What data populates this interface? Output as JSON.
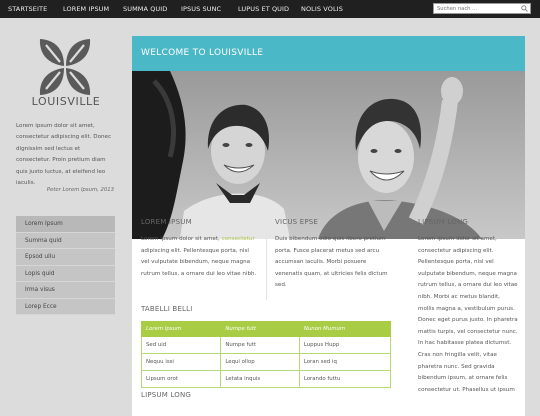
{
  "nav": {
    "items": [
      "STARTSEITE",
      "LOREM IPSUM",
      "SUMMA QUID",
      "IPSUS SUNC",
      "LUPUS ET QUID",
      "NOLIS VOLIS"
    ],
    "search_placeholder": "Suchen nach ..."
  },
  "sidebar": {
    "brand": "LOUISVILLE",
    "intro": "Lorem ipsum dolor sit amet, consectetur adipiscing elit. Donec dignissim sed lectus et consectetur. Proin pretium diam quis justo luctus, at eleifend leo iaculis.",
    "quote": "Peter Lorem Ipsum, 2013",
    "menu": [
      "Lorem Ipsum",
      "Summa quid",
      "Epsod ullu",
      "Lopis quid",
      "Irma visus",
      "Lorep Ecce"
    ]
  },
  "main": {
    "welcome": "WELCOME TO LOUISVILLE",
    "col1": {
      "heading": "LOREM IPSUM",
      "text_a": "Lorem ipsum dolor sit amet, ",
      "link": "consectetur",
      "text_b": " adipiscing elit. Pellentesque porta, nisl vel vulputate bibendum, neque magna rutrum tellus, a ornare dui leo vitae nibh."
    },
    "col2": {
      "heading": "VICUS EPSE",
      "text": "Duis bibendum odio quis libero pretium porta. Fusce placerat metus sed arcu accumsan iaculis. Morbi posuere venenatis quam, at ultricies felis dictum sed."
    },
    "col3": {
      "heading": "LIPSUM LONG",
      "text": "Lorem ipsum dolor sit amet, consectetur adipiscing elit. Pellentesque porta, nisl vel vulputate bibendum, neque magna rutrum tellus, a ornare dui leo vitae nibh. Morbi ac metus blandit, mollis magna a, vestibulum purus. Donec eget purus justo. In pharetra mattis turpis, vel consectetur nunc. In hac habitasse platea dictumst. Cras non fringilla velit, vitae pharetra nunc. Sed gravida bibendum ipsum, at ornare felis consectetur ut. Phasellus ut ipsum"
    },
    "table": {
      "heading": "TABELLI BELLI",
      "columns": [
        "Lorem Ipsum",
        "Numpe futt",
        "Nunon Mumum"
      ],
      "rows": [
        [
          "Sed uid",
          "Numpe futt",
          "Luppus Hupp"
        ],
        [
          "Nequu issi",
          "Lequi ollop",
          "Loran sed iq"
        ],
        [
          "Lipsum orot",
          "Letata inquis",
          "Lorando futtu"
        ]
      ]
    },
    "bottom_heading": "LIPSUM LONG"
  },
  "colors": {
    "accent": "#4ab8c6",
    "table_green": "#a8cc44",
    "link_green": "#aac34a",
    "topbar": "#202020"
  }
}
